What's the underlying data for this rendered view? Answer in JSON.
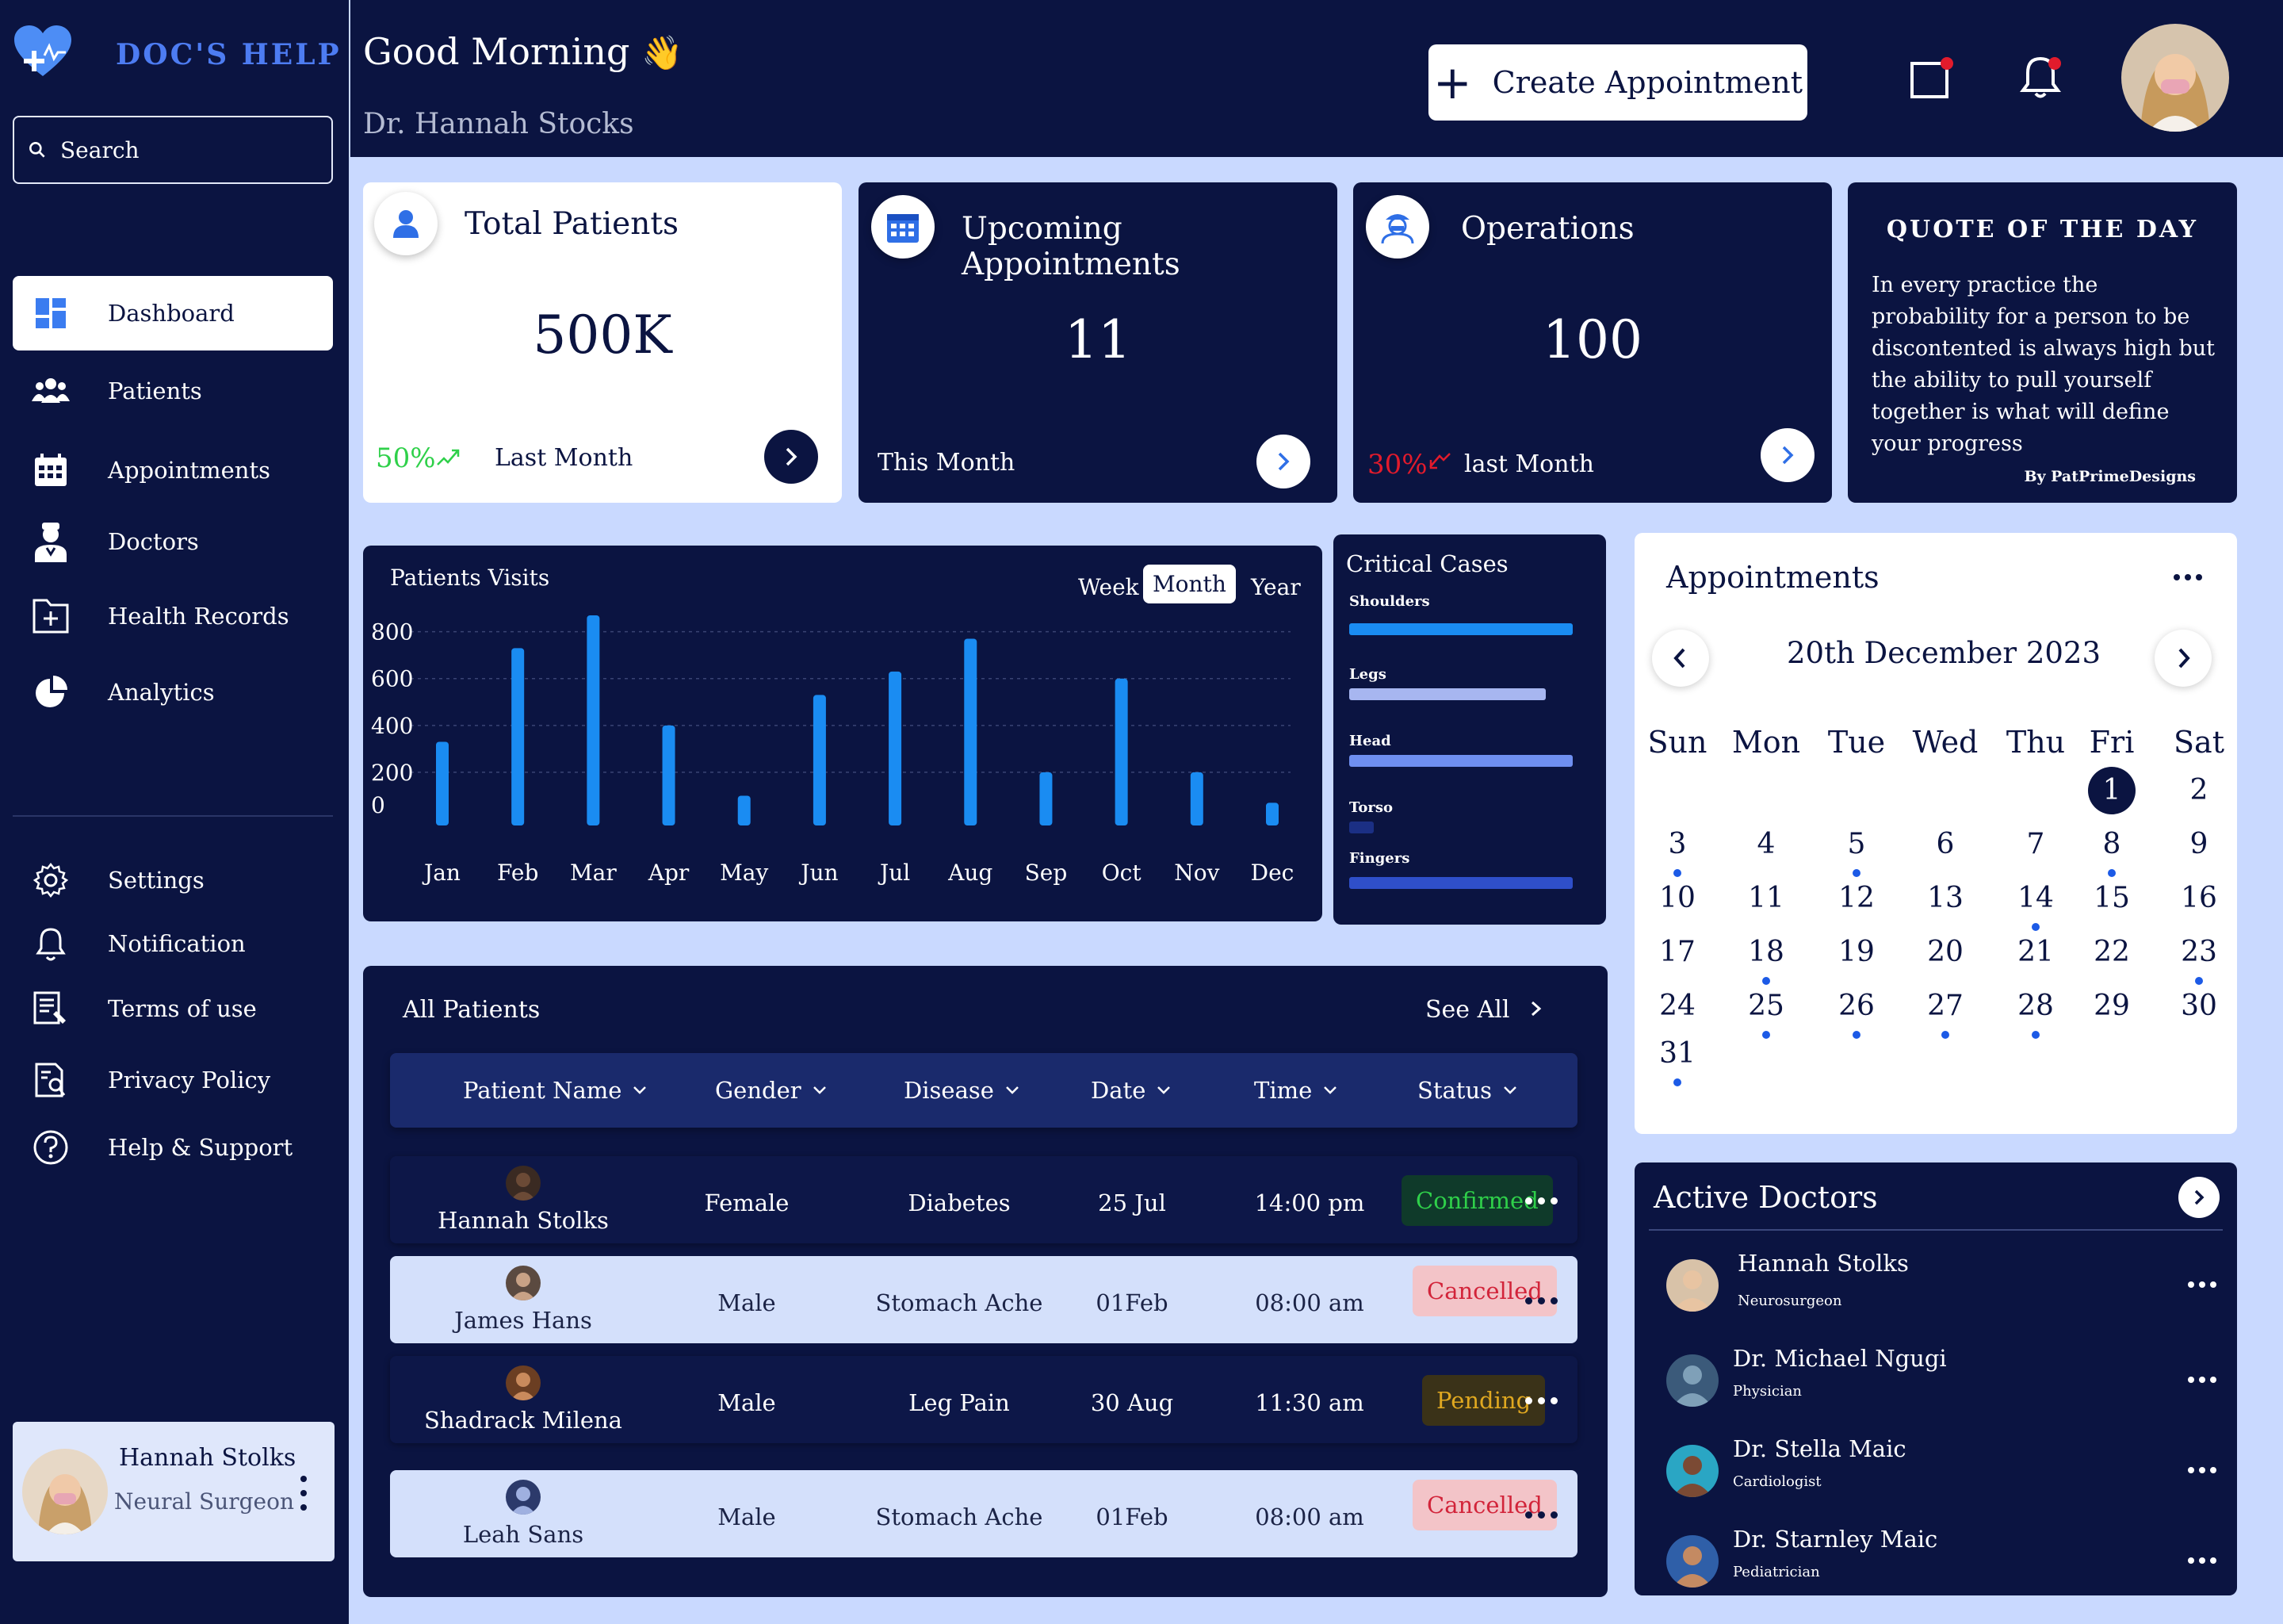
{
  "brand": {
    "name": "DOC'S HELP"
  },
  "search": {
    "placeholder": "Search"
  },
  "sidebar": {
    "items": [
      {
        "label": "Dashboard",
        "icon": "dashboard-icon"
      },
      {
        "label": "Patients",
        "icon": "patients-icon"
      },
      {
        "label": "Appointments",
        "icon": "calendar-icon"
      },
      {
        "label": "Doctors",
        "icon": "doctor-icon"
      },
      {
        "label": "Health Records",
        "icon": "folder-plus-icon"
      },
      {
        "label": "Analytics",
        "icon": "pie-chart-icon"
      }
    ],
    "bottom_items": [
      {
        "label": "Settings",
        "icon": "gear-icon"
      },
      {
        "label": "Notification",
        "icon": "bell-icon"
      },
      {
        "label": "Terms of use",
        "icon": "document-icon"
      },
      {
        "label": "Privacy Policy",
        "icon": "privacy-icon"
      },
      {
        "label": "Help  & Support",
        "icon": "help-icon"
      }
    ],
    "user": {
      "name": "Hannah Stolks",
      "role": "Neural Surgeon"
    }
  },
  "header": {
    "greeting": "Good Morning",
    "greeting_emoji": "👋",
    "doctor_name": "Dr. Hannah Stocks",
    "create_label": "Create  Appointment"
  },
  "stats": {
    "total_patients": {
      "title": "Total Patients",
      "value": "500K",
      "change": "50%",
      "period": "Last Month"
    },
    "upcoming": {
      "title": "Upcoming Appointments",
      "value": "11",
      "period": "This Month"
    },
    "operations": {
      "title": "Operations",
      "value": "100",
      "change": "30%",
      "period": "last Month"
    }
  },
  "quote": {
    "title": "QUOTE OF THE DAY",
    "text": "In every practice the probability for a person  to be discontented is always high but the ability to pull yourself together is what will define your progress",
    "author": "By PatPrimeDesigns"
  },
  "visits": {
    "title": "Patients Visits",
    "tabs": [
      "Week",
      "Month",
      "Year"
    ],
    "active_tab": "Month"
  },
  "chart_data": {
    "type": "bar",
    "title": "Patients Visits",
    "categories": [
      "Jan",
      "Feb",
      "Mar",
      "Apr",
      "May",
      "Jun",
      "Jul",
      "Aug",
      "Sep",
      "Oct",
      "Nov",
      "Dec"
    ],
    "values": [
      330,
      730,
      870,
      400,
      100,
      530,
      630,
      770,
      200,
      600,
      200,
      70
    ],
    "yticks": [
      0,
      200,
      400,
      600,
      800
    ],
    "ylim": [
      0,
      880
    ],
    "grid": true,
    "color": "#1a8cf2"
  },
  "critical": {
    "title": "Critical Cases",
    "items": [
      {
        "label": "Shoulders",
        "value": 1.0,
        "color": "#1a8cf2"
      },
      {
        "label": "Legs",
        "value": 0.88,
        "color": "#a7b6f0"
      },
      {
        "label": "Head",
        "value": 1.0,
        "color": "#6f8ff0"
      },
      {
        "label": "Torso",
        "value": 0.11,
        "color": "#1b2f84"
      },
      {
        "label": "Fingers",
        "value": 1.0,
        "color": "#2f4fc9"
      }
    ]
  },
  "calendar": {
    "title": "Appointments",
    "month_label": "20th December 2023",
    "weekdays": [
      "Sun",
      "Mon",
      "Tue",
      "Wed",
      "Thu",
      "Fri",
      "Sat"
    ],
    "selected_day": 1,
    "first_weekday": 5,
    "days_in_month": 31,
    "days_with_events": [
      3,
      5,
      8,
      14,
      18,
      23,
      25,
      26,
      27,
      28,
      31
    ]
  },
  "patients": {
    "title": "All Patients",
    "see_all": "See All",
    "columns": [
      "Patient Name",
      "Gender",
      "Disease",
      "Date",
      "Time",
      "Status"
    ],
    "rows": [
      {
        "name": "Hannah Stolks",
        "gender": "Female",
        "disease": "Diabetes",
        "date": "25 Jul",
        "time": "14:00 pm",
        "status": "Confirmed"
      },
      {
        "name": "James Hans",
        "gender": "Male",
        "disease": "Stomach Ache",
        "date": "01Feb",
        "time": "08:00 am",
        "status": "Cancelled"
      },
      {
        "name": "Shadrack Milena",
        "gender": "Male",
        "disease": "Leg Pain",
        "date": "30 Aug",
        "time": "11:30 am",
        "status": "Pending"
      },
      {
        "name": "Leah Sans",
        "gender": "Male",
        "disease": "Stomach Ache",
        "date": "01Feb",
        "time": "08:00 am",
        "status": "Cancelled"
      }
    ],
    "status_colors": {
      "Confirmed": "#2fd04a",
      "Cancelled": "#d2243a",
      "Pending": "#e0a820"
    }
  },
  "doctors": {
    "title": "Active Doctors",
    "list": [
      {
        "name": "Hannah Stolks",
        "specialty": "Neurosurgeon"
      },
      {
        "name": "Dr. Michael Ngugi",
        "specialty": "Physician"
      },
      {
        "name": "Dr. Stella Maic",
        "specialty": "Cardiologist"
      },
      {
        "name": "Dr. Starnley Maic",
        "specialty": "Pediatrician"
      }
    ]
  },
  "colors": {
    "navy": "#0b1441",
    "accent": "#4d7cf2",
    "bar": "#1a8cf2",
    "background": "#c9d9ff"
  }
}
